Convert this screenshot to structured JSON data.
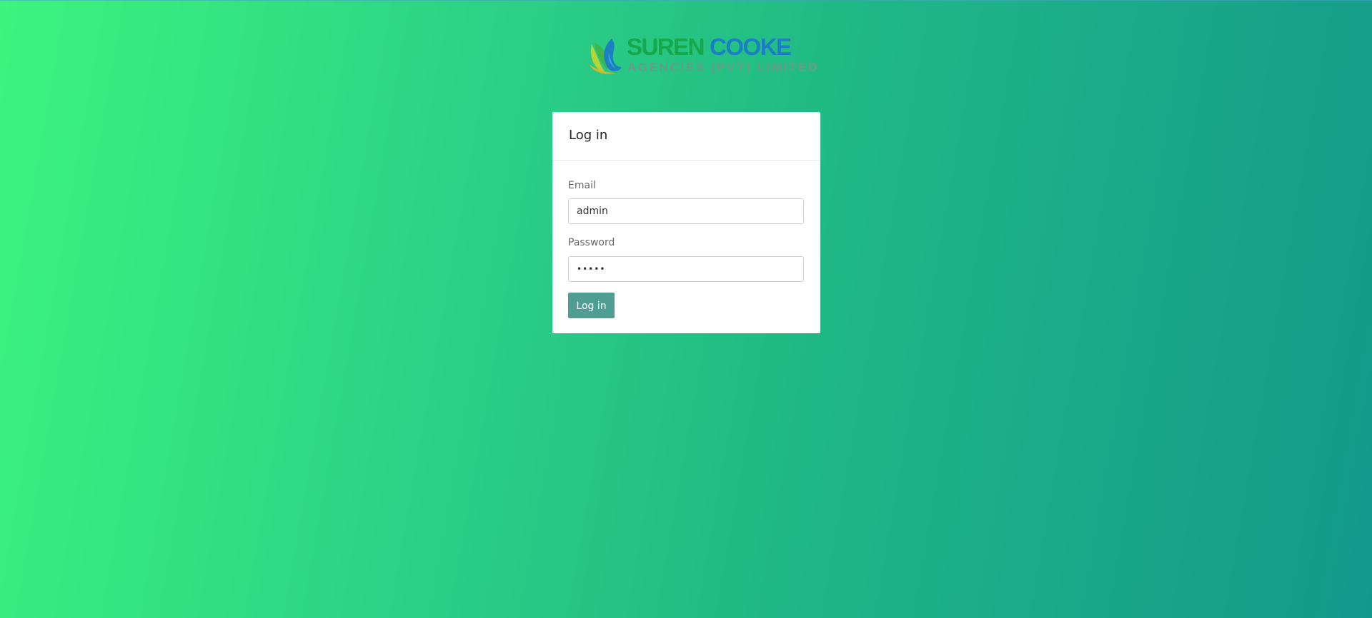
{
  "brand": {
    "title_word1": "SUREN",
    "title_word2": "COOKE",
    "subtitle": "AGENCIES (PVT) LIMITED",
    "colors": {
      "title_green": "#17a84a",
      "title_blue": "#1c7fc4",
      "subtitle": "#6b9a8c"
    },
    "icon": "leaf-flame-logo-icon"
  },
  "login": {
    "title": "Log in",
    "email": {
      "label": "Email",
      "value": "admin"
    },
    "password": {
      "label": "Password",
      "value": "•••••"
    },
    "submit_label": "Log in"
  },
  "theme": {
    "background_gradient": [
      "#3cf47e",
      "#13998c"
    ],
    "button_color": "#4f9e94"
  }
}
